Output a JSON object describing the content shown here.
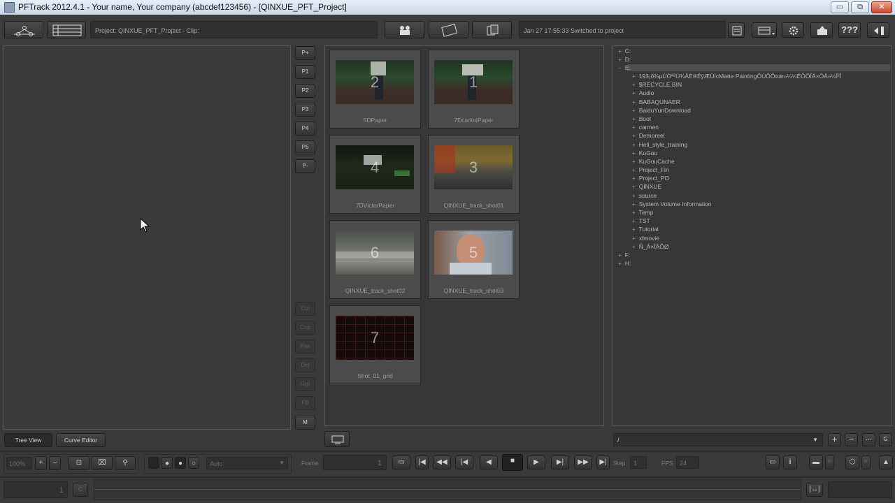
{
  "window": {
    "title": "PFTrack 2012.4.1 - Your name, Your company (abcdef123456) - [QINXUE_PFT_Project]",
    "minimize": "▭",
    "maximize": "⧉",
    "close": "✕"
  },
  "toolbar": {
    "project_info": "Project: QINXUE_PFT_Project - Clip:",
    "status_message": "Jan 27 17:55:33 Switched to project",
    "help_label": "???"
  },
  "side_buttons": [
    "P+",
    "P1",
    "P2",
    "P3",
    "P4",
    "P5",
    "P-"
  ],
  "side_buttons_lower": [
    "Cut",
    "Cop",
    "Pas",
    "Del",
    "Grp",
    "Fill",
    "M"
  ],
  "clips": [
    {
      "number": "2",
      "name": "5DPaper"
    },
    {
      "number": "1",
      "name": "7DcarlosPaper"
    },
    {
      "number": "4",
      "name": "7DVictorPaper"
    },
    {
      "number": "3",
      "name": "QINXUE_track_shot01"
    },
    {
      "number": "6",
      "name": "QINXUE_track_shot02"
    },
    {
      "number": "5",
      "name": "QINXUE_track_shot03"
    },
    {
      "number": "7",
      "name": "Shot_01_grid"
    }
  ],
  "file_tree": {
    "drives_top": [
      "C:",
      "D:",
      "E:"
    ],
    "e_children": [
      "193¡õ¾µÚÒª²Ú¾ÂÈ®ÉýÆÜícMatte PaintingÕÚÔÕ¤æ»¼¼ÉÕÖÎÄ×ÖÄ»½Î²Î",
      "$RECYCLE.BIN",
      "Audio",
      "BABAQUNAER",
      "BaiduYunDownload",
      "Boot",
      "carmen",
      "Demoreel",
      "Hell_style_training",
      "KuGou",
      "KuGouCache",
      "Project_Fin",
      "Project_PO",
      "QINXUE",
      "source",
      "System Volume Information",
      "Temp",
      "TST",
      "Tutorial",
      "xfmovie",
      "Ñ_Á×ÎÄÕØ"
    ],
    "drives_bottom": [
      "F:",
      "H:"
    ],
    "path_value": "/"
  },
  "bottom_tabs": {
    "tree_view": "Tree View",
    "curve_editor": "Curve Editor"
  },
  "transport": {
    "zoom": "100%",
    "mode": "Auto",
    "frame_label": "Frame",
    "frame_value": "1",
    "step_label": "Step",
    "step_value": "1",
    "fps_label": "FPS",
    "fps_value": "24",
    "timeline_start": "1",
    "timeline_c": "C"
  }
}
